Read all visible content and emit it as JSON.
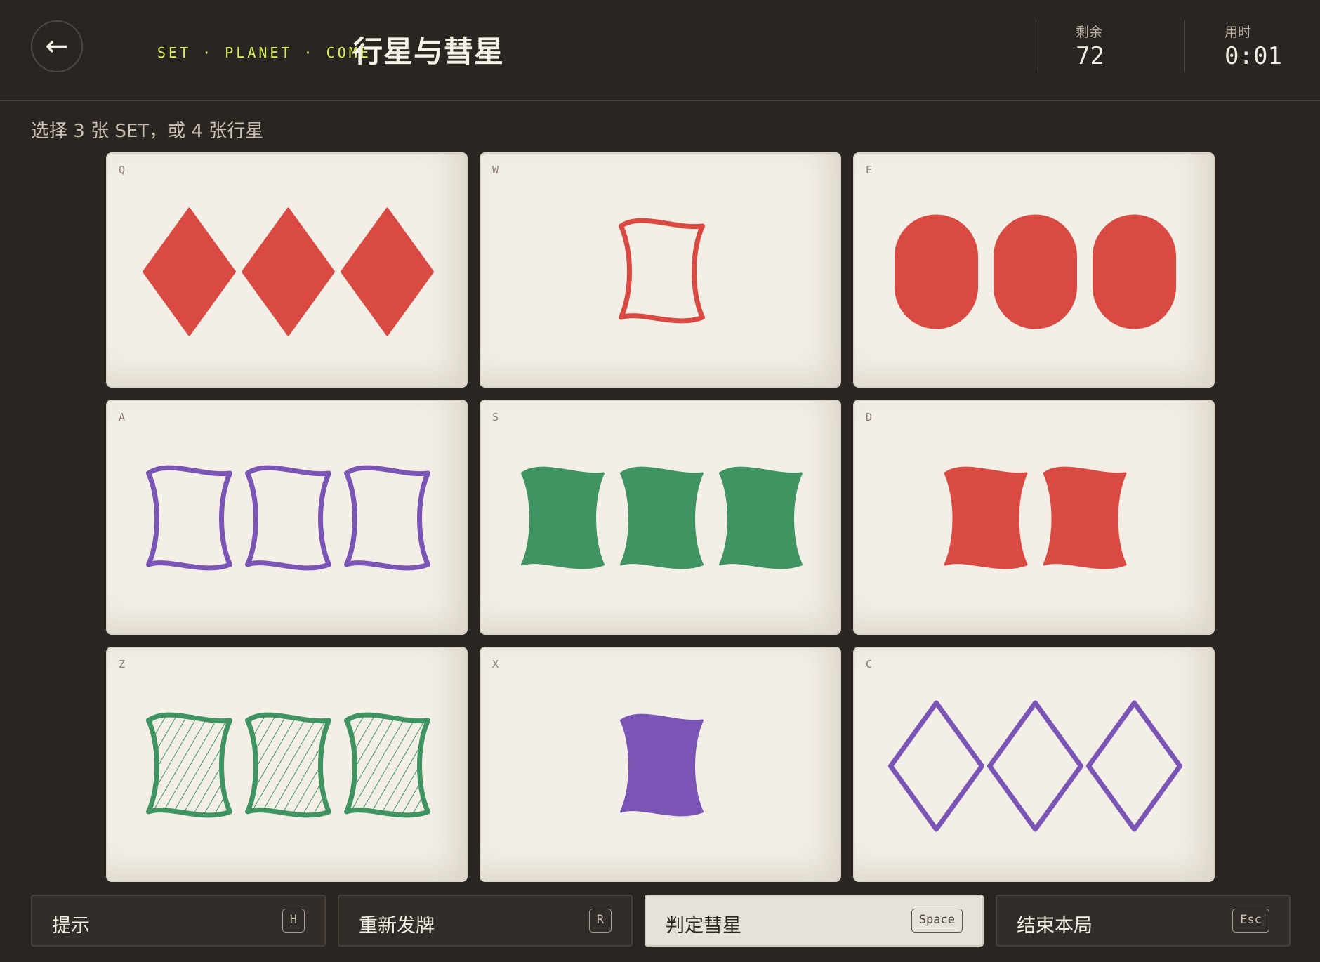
{
  "header": {
    "back_label": "←",
    "brand": "SET · PLANET · COMET",
    "title": "行星与彗星",
    "remaining_label": "剩余",
    "remaining_value": "72",
    "time_label": "用时",
    "time_value": "0:01"
  },
  "instruction": "选择 3 张 SET，或 4 张行星",
  "colors": {
    "red": "#d94a42",
    "green": "#3f9462",
    "purple": "#7a55b5",
    "background": "#2a2521",
    "card": "#f3efe7",
    "brand_accent": "#d6f25a"
  },
  "cards": [
    {
      "key": "Q",
      "count": 3,
      "shape": "diamond",
      "color": "red",
      "fill": "solid"
    },
    {
      "key": "W",
      "count": 1,
      "shape": "squiggle",
      "color": "red",
      "fill": "outline"
    },
    {
      "key": "E",
      "count": 3,
      "shape": "oval",
      "color": "red",
      "fill": "solid"
    },
    {
      "key": "A",
      "count": 3,
      "shape": "squiggle",
      "color": "purple",
      "fill": "outline"
    },
    {
      "key": "S",
      "count": 3,
      "shape": "squiggle",
      "color": "green",
      "fill": "solid"
    },
    {
      "key": "D",
      "count": 2,
      "shape": "squiggle",
      "color": "red",
      "fill": "solid"
    },
    {
      "key": "Z",
      "count": 3,
      "shape": "squiggle",
      "color": "green",
      "fill": "striped"
    },
    {
      "key": "X",
      "count": 1,
      "shape": "squiggle",
      "color": "purple",
      "fill": "solid"
    },
    {
      "key": "C",
      "count": 3,
      "shape": "diamond",
      "color": "purple",
      "fill": "outline"
    }
  ],
  "buttons": [
    {
      "label": "提示",
      "key": "H"
    },
    {
      "label": "重新发牌",
      "key": "R"
    },
    {
      "label": "判定彗星",
      "key": "Space"
    },
    {
      "label": "结束本局",
      "key": "Esc"
    }
  ]
}
